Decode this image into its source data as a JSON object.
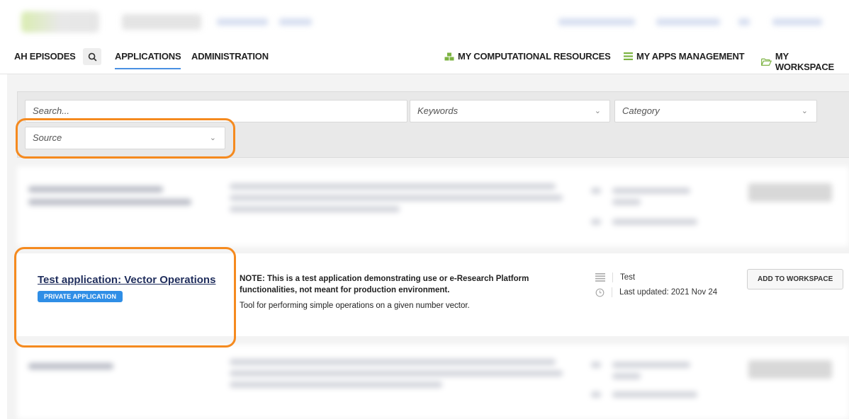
{
  "nav": {
    "ah_episodes": "AH EPISODES",
    "applications": "APPLICATIONS",
    "administration": "ADMINISTRATION",
    "computational_resources": "MY COMPUTATIONAL RESOURCES",
    "apps_management": "MY APPS MANAGEMENT",
    "workspace": "MY WORKSPACE"
  },
  "filters": {
    "search_placeholder": "Search...",
    "keywords": "Keywords",
    "category": "Category",
    "source": "Source"
  },
  "app": {
    "title": "Test application: Vector Operations",
    "badge": "PRIVATE APPLICATION",
    "note": "NOTE: This is a test application demonstrating use or e-Research Platform functionalities, not meant for production environment.",
    "description": "Tool for performing simple operations on a given number vector.",
    "category": "Test",
    "updated": "Last updated: 2021 Nov 24",
    "add_button": "ADD TO WORKSPACE"
  },
  "colors": {
    "accent_blue": "#2f8ee6",
    "highlight_orange": "#f58a1f",
    "title_navy": "#1f2d5c"
  }
}
